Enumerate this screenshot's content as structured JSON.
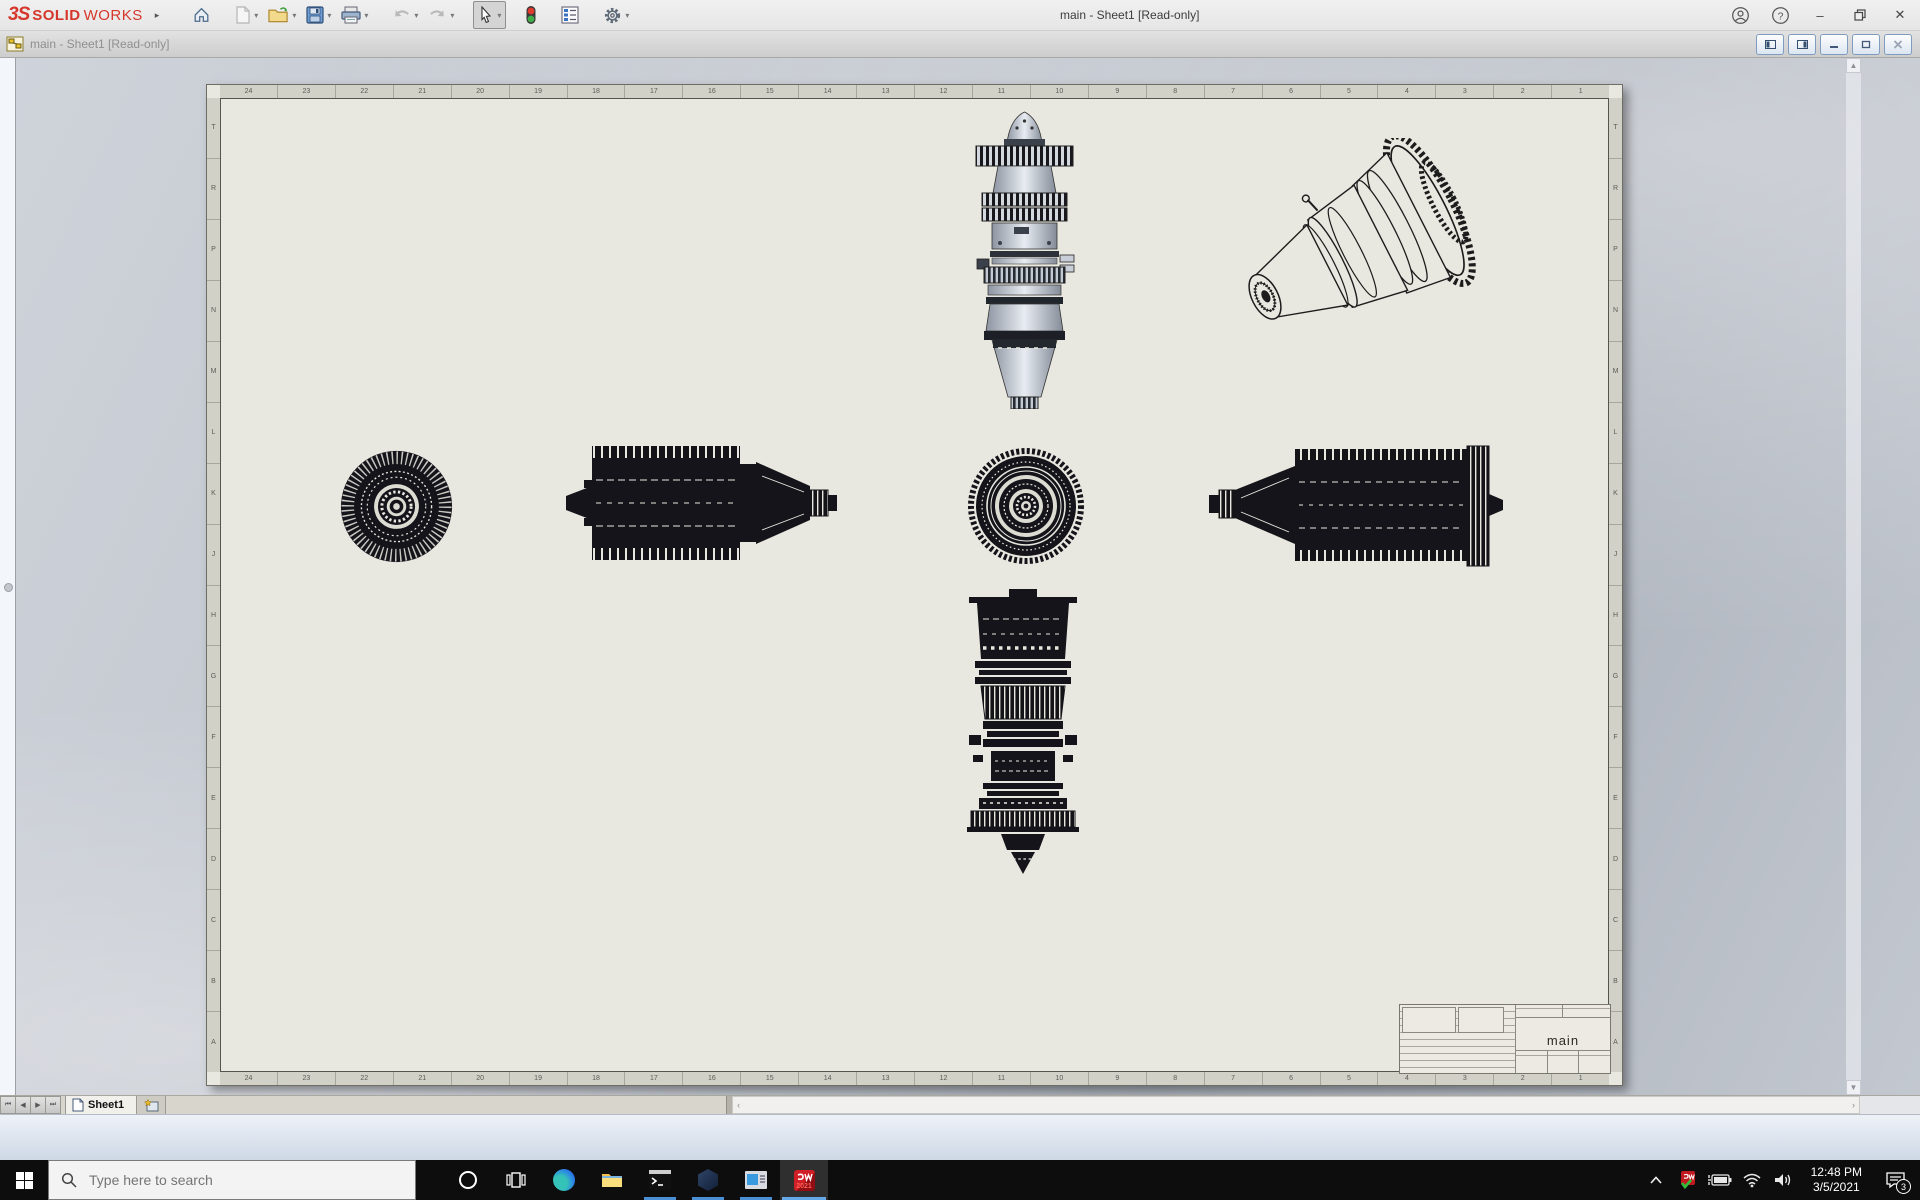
{
  "titlebar": {
    "brand_mark": "3S",
    "brand_bold": "SOLID",
    "brand_light": "WORKS",
    "title": "main - Sheet1 [Read-only]",
    "toolbar_icons": [
      "home",
      "new-document",
      "open",
      "save",
      "print",
      "undo",
      "redo",
      "select",
      "rebuild",
      "display-report",
      "options",
      "user-account",
      "help"
    ]
  },
  "document_window": {
    "title": "main - Sheet1 [Read-only]",
    "buttons": [
      "pane-left",
      "pane-right",
      "minimize",
      "restore",
      "close"
    ]
  },
  "sheet": {
    "tab_label": "Sheet1",
    "zone_numbers": [
      "24",
      "23",
      "22",
      "21",
      "20",
      "19",
      "18",
      "17",
      "16",
      "15",
      "14",
      "13",
      "12",
      "11",
      "10",
      "9",
      "8",
      "7",
      "6",
      "5",
      "4",
      "3",
      "2",
      "1"
    ],
    "zone_letters": [
      "T",
      "R",
      "P",
      "N",
      "M",
      "L",
      "K",
      "J",
      "H",
      "G",
      "F",
      "E",
      "D",
      "C",
      "B",
      "A"
    ],
    "title_block": {
      "title": "main"
    },
    "views": [
      "front-view-shaded",
      "isometric-view",
      "left-fan-view",
      "side-view-left",
      "rear-circular-view",
      "side-view-right",
      "bottom-view"
    ]
  },
  "taskbar": {
    "search_placeholder": "Type here to search",
    "app_badge_year": "2021",
    "icons": [
      "start",
      "search",
      "cortana",
      "task-view",
      "edge",
      "file-explorer",
      "command-prompt",
      "hexagon-app",
      "display-app",
      "solidworks-2021"
    ]
  },
  "tray": {
    "icons": [
      "chevron-up",
      "solidworks-monitor",
      "battery",
      "wifi",
      "volume",
      "clock",
      "notifications"
    ],
    "time": "12:48 PM",
    "date": "3/5/2021",
    "notification_count": "3"
  },
  "colors": {
    "brand_red": "#d6372c",
    "paper": "#e9e8e0",
    "taskbar": "#0d0d0d",
    "running_underline": "#4a8fd4",
    "status_gradient_top": "#eef2f8"
  }
}
